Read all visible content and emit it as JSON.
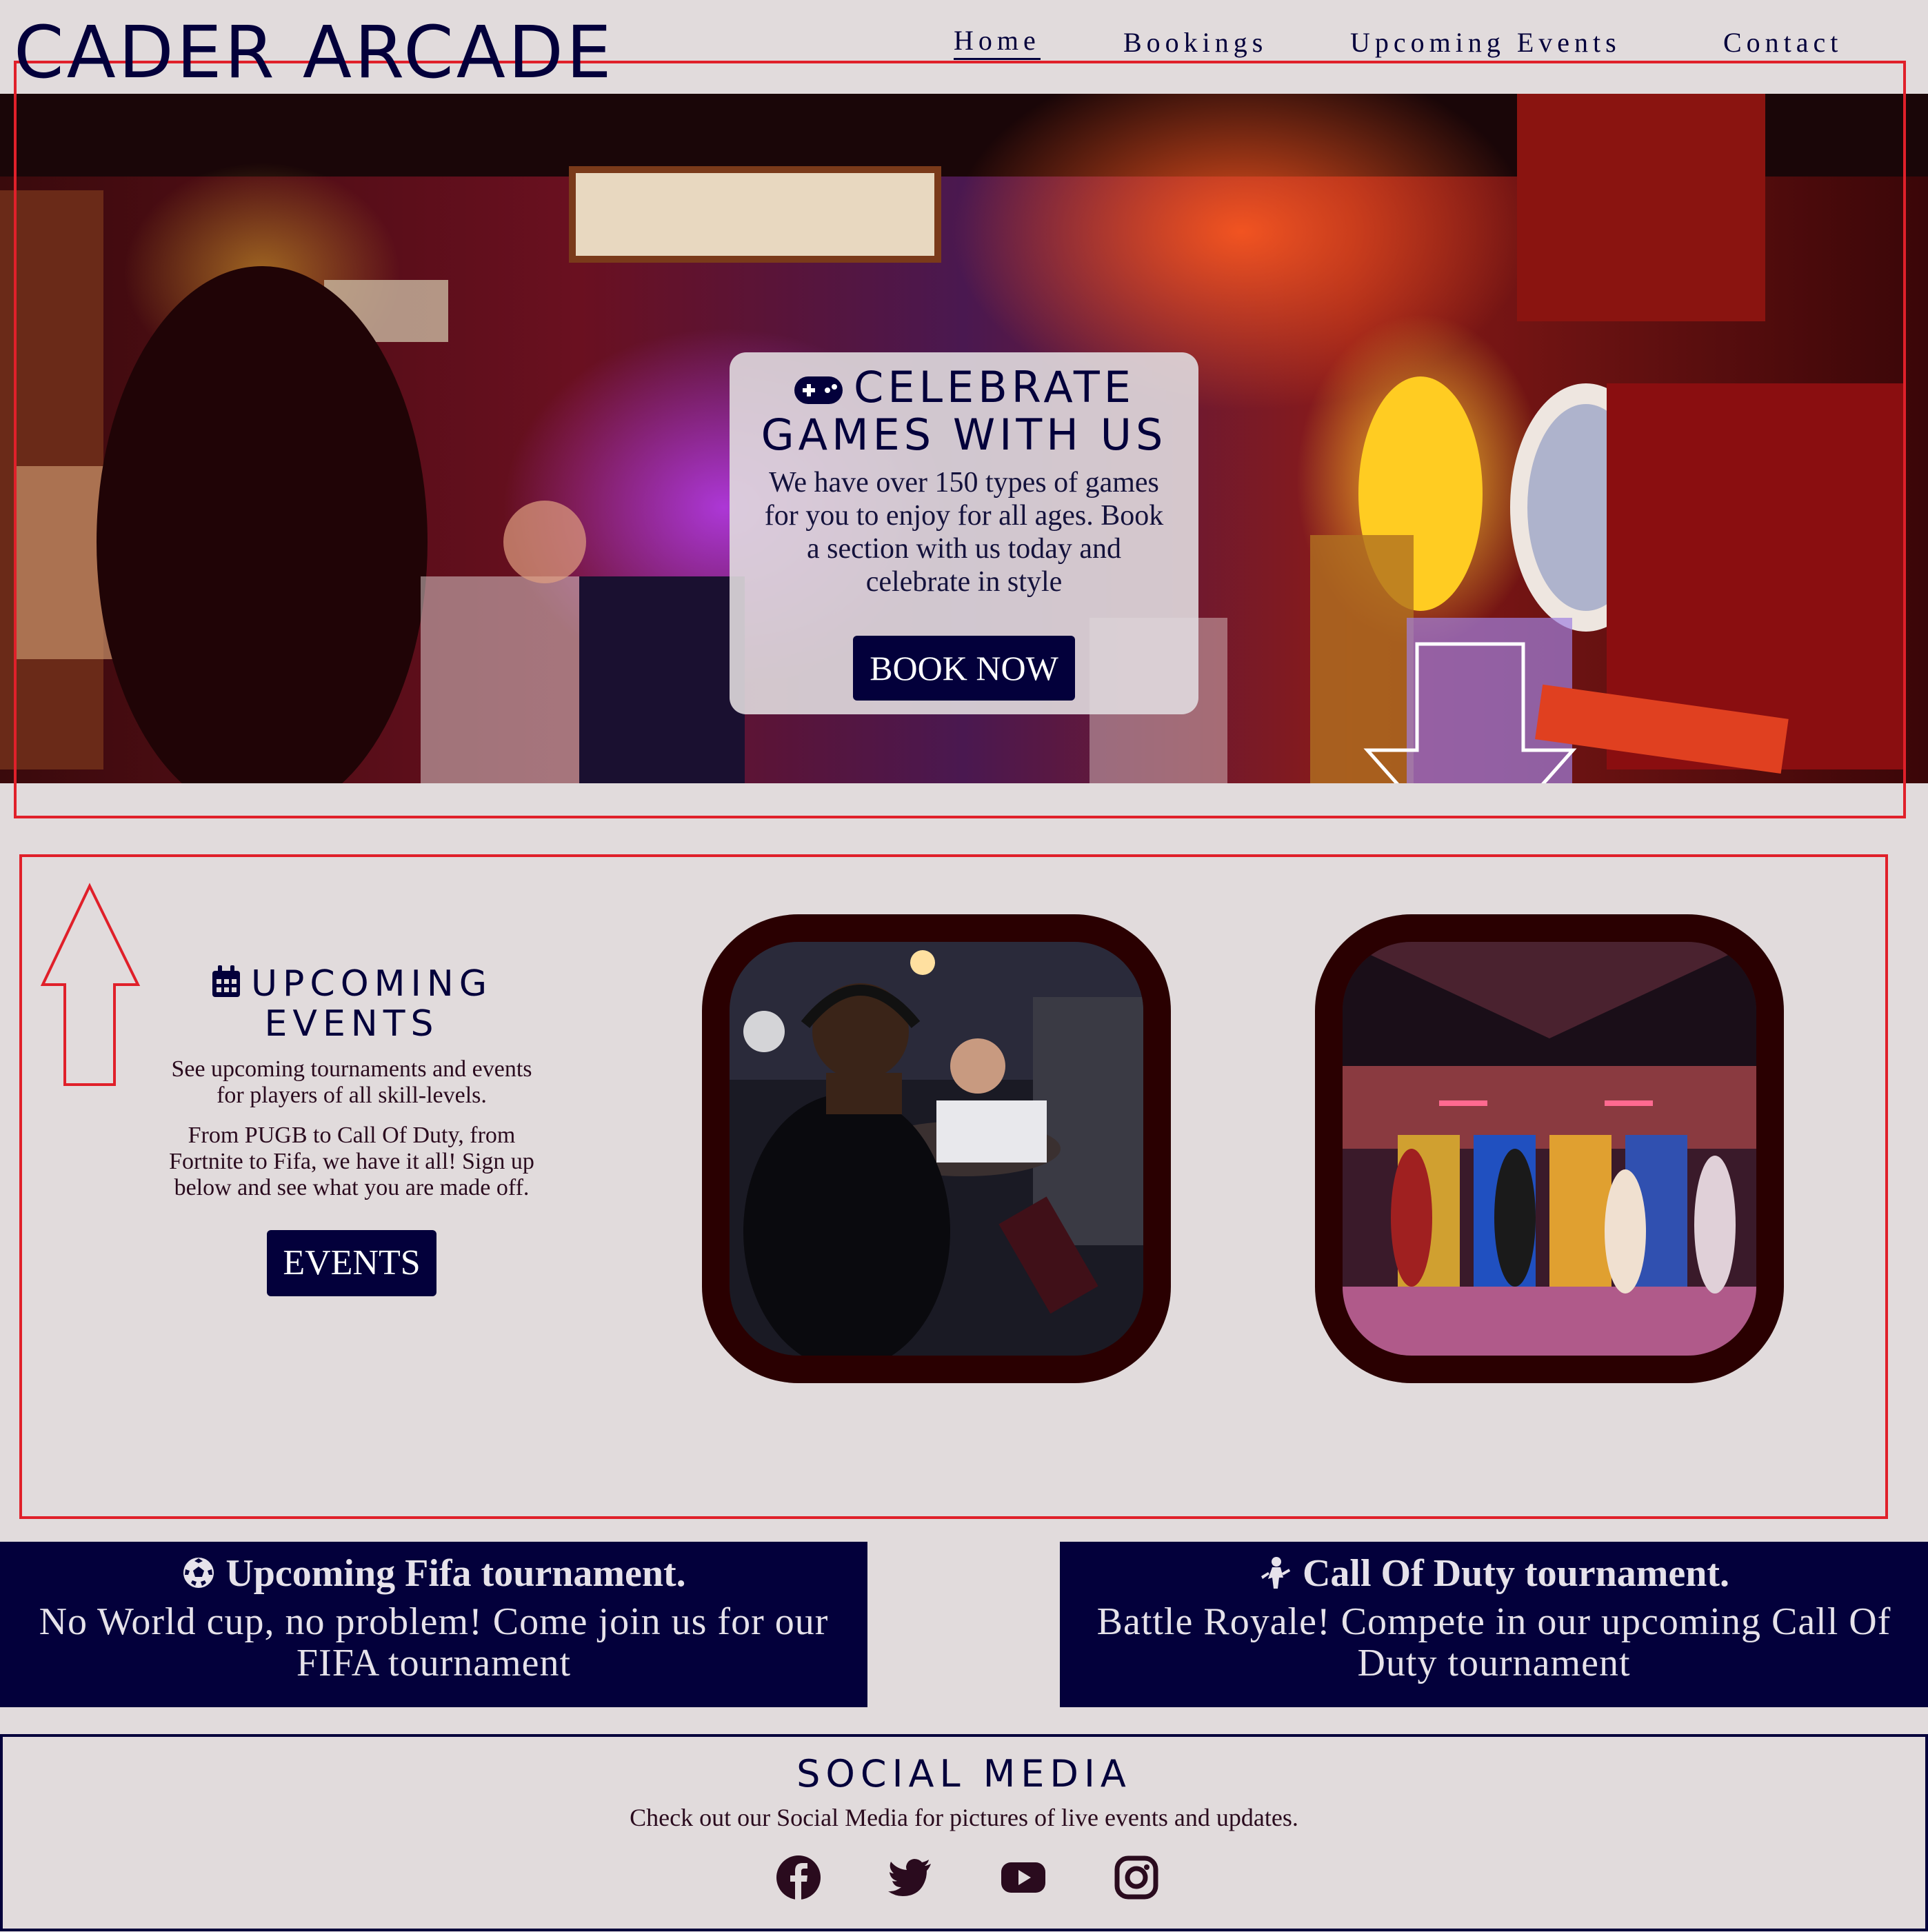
{
  "header": {
    "brand": "CADER ARCADE",
    "nav": [
      {
        "label": "Home",
        "active": true
      },
      {
        "label": "Bookings",
        "active": false
      },
      {
        "label": "Upcoming Events",
        "active": false
      },
      {
        "label": "Contact",
        "active": false
      }
    ]
  },
  "hero": {
    "title": "CELEBRATE GAMES WITH US",
    "text": "We have over 150 types of games for you to enjoy for all ages. Book a section with us today and celebrate in style",
    "button": "BOOK NOW",
    "icon": "gamepad-icon"
  },
  "events": {
    "title": "UPCOMING EVENTS",
    "icon": "calendar-icon",
    "text1": "See upcoming tournaments and events for players of all skill-levels.",
    "text2": "From PUGB to Call Of Duty, from Fortnite to Fifa, we have it all! Sign up below and see what you are made off.",
    "button": "EVENTS"
  },
  "tournaments": [
    {
      "icon": "soccer-ball-icon",
      "title": "Upcoming Fifa tournament.",
      "text": "No World cup, no problem! Come join us for our FIFA tournament"
    },
    {
      "icon": "soldier-icon",
      "title": "Call Of Duty tournament.",
      "text": "Battle Royale! Compete in our upcoming Call Of Duty tournament"
    }
  ],
  "social": {
    "title": "SOCIAL MEDIA",
    "text": "Check out our Social Media for pictures of live events and updates.",
    "icons": [
      "facebook-icon",
      "twitter-icon",
      "youtube-icon",
      "instagram-icon"
    ]
  },
  "colors": {
    "background": "#e1dbdc",
    "navy": "#03003b",
    "maroon": "#2a0001",
    "annotation_red": "#e0202a"
  }
}
